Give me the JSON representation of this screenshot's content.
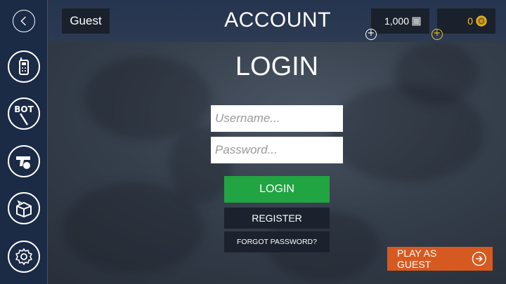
{
  "header": {
    "player_name": "Guest",
    "title": "ACCOUNT",
    "currency_silver": "1,000",
    "currency_gold": "0",
    "gold_color": "#f2c230"
  },
  "login": {
    "title": "LOGIN",
    "username_placeholder": "Username...",
    "password_placeholder": "Password...",
    "login_label": "LOGIN",
    "register_label": "REGISTER",
    "forgot_label": "FORGOT PASSWORD?",
    "guest_label": "PLAY AS GUEST"
  },
  "sidebar": {
    "items": [
      {
        "icon": "back-arrow-icon"
      },
      {
        "icon": "walkie-talkie-icon"
      },
      {
        "icon": "bot-icon",
        "label": "BOT"
      },
      {
        "icon": "pistol-grenade-icon"
      },
      {
        "icon": "crate-icon"
      },
      {
        "icon": "gear-icon"
      }
    ]
  },
  "colors": {
    "sidebar_bg": "#1b2a45",
    "login_green": "#21a442",
    "guest_orange": "#d65a20",
    "dark_button": "#1b222d"
  }
}
